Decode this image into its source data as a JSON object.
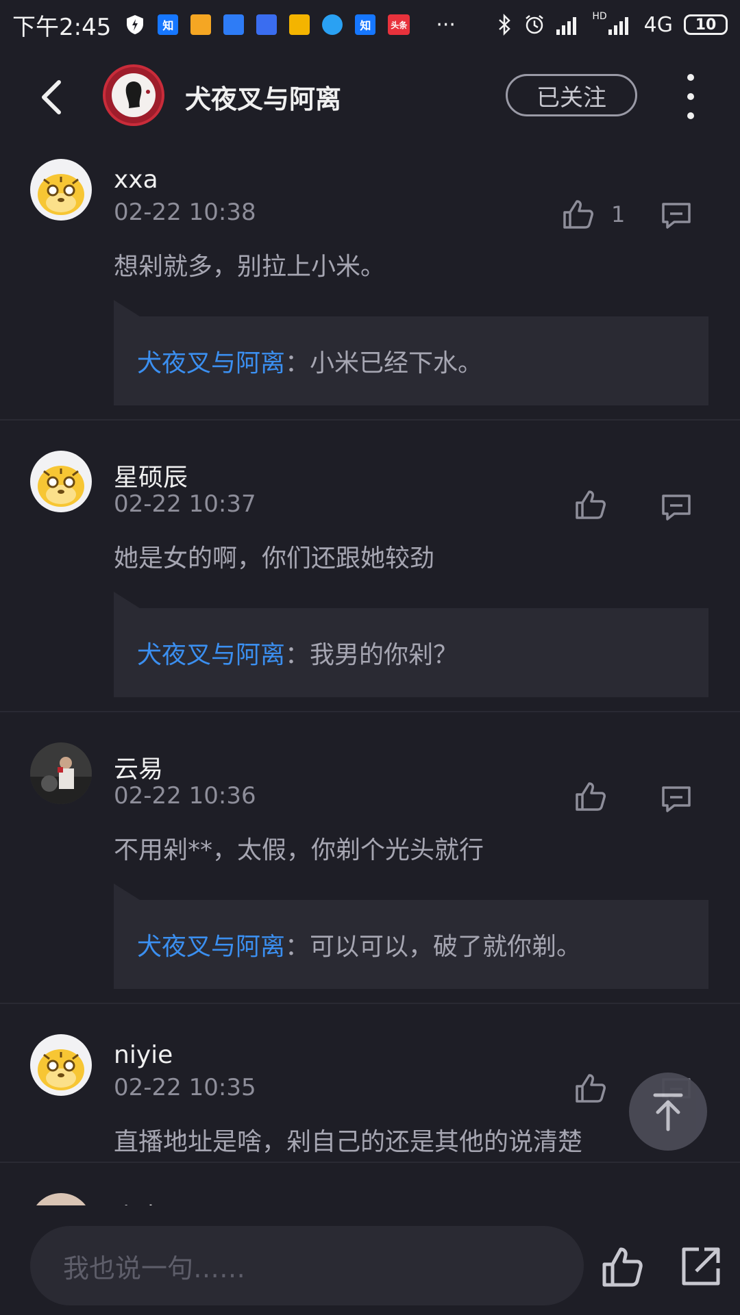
{
  "status_bar": {
    "time": "下午2:45",
    "app_icons": [
      {
        "name": "shield-app-icon",
        "label": "",
        "color": "#ffffff"
      },
      {
        "name": "zhihu-app-icon",
        "label": "知",
        "color": "#1677ff"
      },
      {
        "name": "wallet-app-icon",
        "label": "",
        "color": "#f5a623"
      },
      {
        "name": "tencent-app-icon",
        "label": "",
        "color": "#2e7cf6"
      },
      {
        "name": "baidu-app-icon",
        "label": "",
        "color": "#3a6df0"
      },
      {
        "name": "news-app-icon",
        "label": "",
        "color": "#f4b400"
      },
      {
        "name": "bird-app-icon",
        "label": "",
        "color": "#2aa1f3"
      },
      {
        "name": "zhihu-app-icon-2",
        "label": "知",
        "color": "#1677ff"
      },
      {
        "name": "toutiao-app-icon",
        "label": "头条",
        "color": "#e8323c"
      }
    ],
    "overflow": "···",
    "network": "4G",
    "hd": "HD",
    "battery": "10"
  },
  "header": {
    "title": "犬夜叉与阿离",
    "follow_label": "已关注"
  },
  "comments": [
    {
      "name": "xxa",
      "time": "02-22 10:38",
      "text": "想剁就多，别拉上小米。",
      "likes": "1",
      "reply": {
        "author": "犬夜叉与阿离",
        "text": "：小米已经下水。"
      }
    },
    {
      "name": "星硕辰",
      "time": "02-22 10:37",
      "text": "她是女的啊，你们还跟她较劲",
      "likes": "",
      "reply": {
        "author": "犬夜叉与阿离",
        "text": "：我男的你剁？"
      }
    },
    {
      "name": "云易",
      "time": "02-22 10:36",
      "text": "不用剁**，太假，你剃个光头就行",
      "likes": "",
      "reply": {
        "author": "犬夜叉与阿离",
        "text": "：可以可以，破了就你剃。"
      }
    },
    {
      "name": "niyie",
      "time": "02-22 10:35",
      "text": "直播地址是啥，剁自己的还是其他的说清楚",
      "likes": ""
    },
    {
      "name": "小米雷军"
    }
  ],
  "bottom_bar": {
    "input_placeholder": "我也说一句……"
  }
}
